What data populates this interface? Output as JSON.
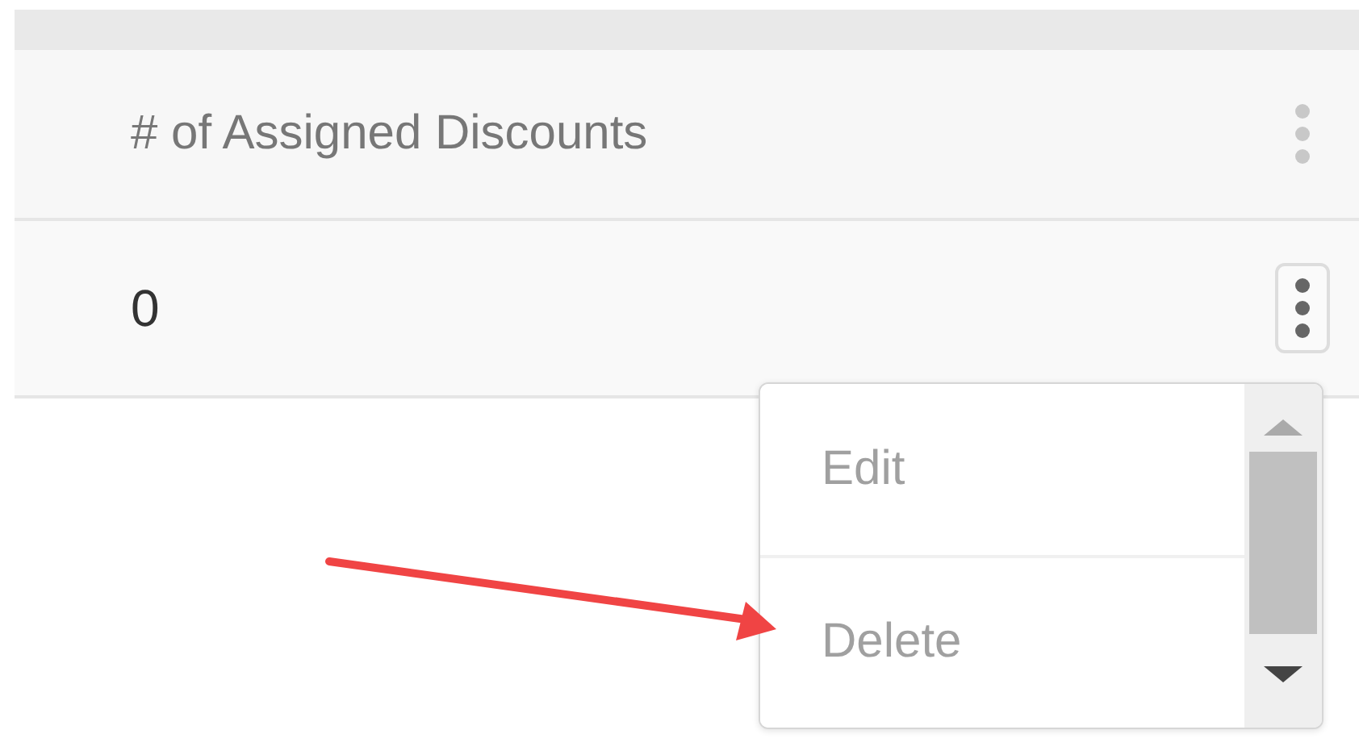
{
  "table": {
    "columns": [
      {
        "label": "# of Assigned Discounts"
      }
    ],
    "rows": [
      {
        "cells": [
          "0"
        ]
      }
    ]
  },
  "row_menu": {
    "items": [
      {
        "label": "Edit"
      },
      {
        "label": "Delete"
      }
    ]
  }
}
